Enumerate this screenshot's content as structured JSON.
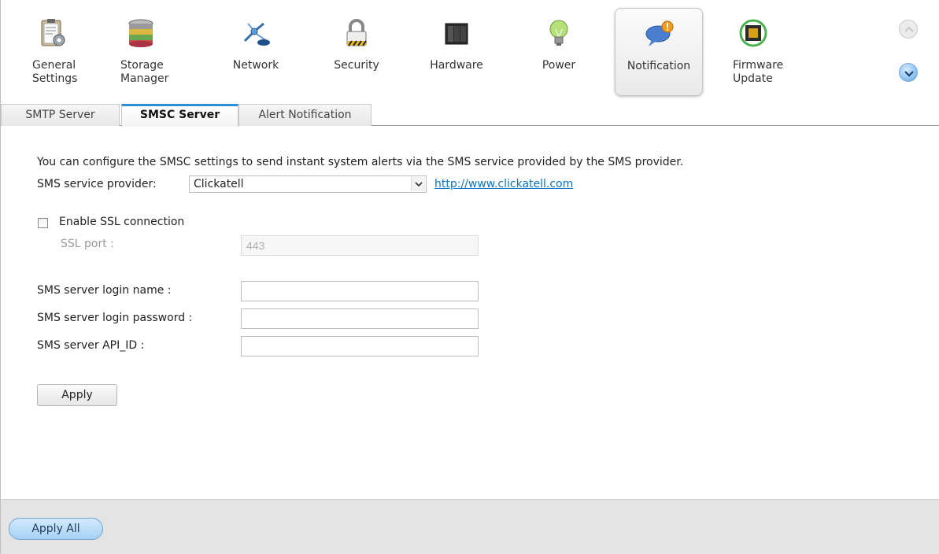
{
  "toolbar": {
    "items": [
      {
        "label": "General\nSettings",
        "icon": "clipboard-gear-icon"
      },
      {
        "label": "Storage\nManager",
        "icon": "database-stack-icon"
      },
      {
        "label": "Network",
        "icon": "network-icon"
      },
      {
        "label": "Security",
        "icon": "lock-icon"
      },
      {
        "label": "Hardware",
        "icon": "server-icon"
      },
      {
        "label": "Power",
        "icon": "lightbulb-icon"
      },
      {
        "label": "Notification",
        "icon": "chat-bubble-alert-icon"
      },
      {
        "label": "Firmware\nUpdate",
        "icon": "chip-update-icon"
      }
    ],
    "active": "Notification"
  },
  "tabs": [
    {
      "label": "SMTP Server"
    },
    {
      "label": "SMSC Server"
    },
    {
      "label": "Alert Notification"
    }
  ],
  "active_tab": "SMSC Server",
  "form": {
    "description": "You can configure the SMSC settings to send instant system alerts via the SMS service provided by the SMS provider.",
    "provider_label": "SMS service provider:",
    "provider_value": "Clickatell",
    "provider_link": "http://www.clickatell.com",
    "ssl_label": "Enable SSL connection",
    "ssl_port_label": "SSL port :",
    "ssl_port_value": "443",
    "login_name_label": "SMS server login name :",
    "login_name_value": "",
    "login_password_label": "SMS server login password :",
    "login_password_value": "",
    "api_id_label": "SMS server API_ID :",
    "api_id_value": "",
    "apply_label": "Apply"
  },
  "footer": {
    "apply_all_label": "Apply All"
  },
  "colors": {
    "accent": "#2e8fd8",
    "link": "#0b72c4",
    "footer_bg": "#e4e4e4"
  }
}
